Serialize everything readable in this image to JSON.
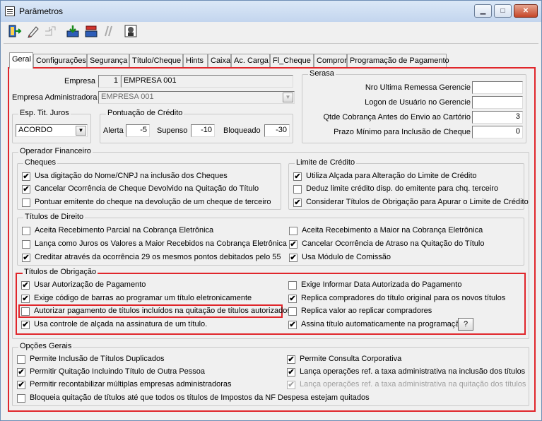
{
  "window": {
    "title": "Parâmetros",
    "minimize": "▁",
    "maximize": "□",
    "close": "✕"
  },
  "toolbar": {
    "icons": [
      "exit-icon",
      "edit-icon",
      "new-icon",
      "save-icon",
      "cancel-icon",
      "search-icon",
      "help-icon"
    ]
  },
  "tabs": [
    "Geral",
    "Configurações",
    "Segurança",
    "Título/Cheque",
    "Hints",
    "Caixa",
    "Ac. Carga",
    "Fl_Cheque",
    "Compror",
    "Programação de Pagamento"
  ],
  "active_tab": "Geral",
  "empresa": {
    "label": "Empresa",
    "code": "1",
    "name": "EMPRESA 001",
    "adm_label": "Empresa  Administradora",
    "adm_value": "EMPRESA 001"
  },
  "esp_tit_juros": {
    "title": "Esp. Tit. Juros",
    "value": "ACORDO"
  },
  "pontuacao": {
    "title": "Pontuação de Crédito",
    "alerta_label": "Alerta",
    "alerta": "-5",
    "supenso_label": "Supenso",
    "supenso": "-10",
    "bloqueado_label": "Bloqueado",
    "bloqueado": "-30"
  },
  "serasa": {
    "title": "Serasa",
    "nro_label": "Nro Ultima Remessa Gerencie",
    "nro": "",
    "logon_label": "Logon de Usuário no Gerencie",
    "logon": "",
    "qtde_label": "Qtde Cobrança  Antes do Envio ao Cartório",
    "qtde": "3",
    "prazo_label": "Prazo Mínimo para Inclusão de Cheque",
    "prazo": "0"
  },
  "operador": {
    "title": "Operador Financeiro",
    "cheques": {
      "title": "Cheques",
      "items": [
        {
          "label": "Usa digitação do Nome/CNPJ na inclusão dos Cheques",
          "checked": "✔"
        },
        {
          "label": "Cancelar Ocorrência de Cheque Devolvido na Quitação do Título",
          "checked": "✔"
        },
        {
          "label": "Pontuar emitente do cheque na devolução de um cheque de terceiro",
          "checked": ""
        }
      ]
    },
    "limite": {
      "title": "Limite de Crédito",
      "items": [
        {
          "label": "Utiliza Alçada para Alteração do Limite de Crédito",
          "checked": "✔"
        },
        {
          "label": "Deduz limite crédito disp. do emitente para chq. terceiro",
          "checked": ""
        },
        {
          "label": "Considerar Títulos de Obrigação para Apurar o Limite de Crédito",
          "checked": "✔"
        }
      ]
    },
    "direito": {
      "title": "Títulos de Direito",
      "left": [
        {
          "label": "Aceita Recebimento Parcial na Cobrança Eletrônica",
          "checked": ""
        },
        {
          "label": "Lança como Juros os Valores a Maior Recebidos na Cobrança Eletrônica",
          "checked": ""
        },
        {
          "label": "Creditar através da ocorrência 29 os mesmos pontos debitados pelo 55",
          "checked": "✔"
        }
      ],
      "right": [
        {
          "label": "Aceita Recebimento a Maior na Cobrança Eletrônica",
          "checked": ""
        },
        {
          "label": "Cancelar Ocorrência de Atraso na Quitação do Título",
          "checked": "✔"
        },
        {
          "label": "Usa Módulo de Comissão",
          "checked": "✔"
        }
      ]
    },
    "obrigacao": {
      "title": "Títulos de Obrigação",
      "left": [
        {
          "label": "Usar Autorização de Pagamento",
          "checked": "✔"
        },
        {
          "label": "Exige código de barras ao programar um título eletronicamente",
          "checked": "✔"
        },
        {
          "label": "Autorizar pagamento de títulos incluídos na quitação de títulos autorizados",
          "checked": ""
        },
        {
          "label": "Usa controle de alçada na assinatura de um título.",
          "checked": "✔"
        }
      ],
      "right": [
        {
          "label": "Exige Informar Data Autorizada do Pagamento",
          "checked": ""
        },
        {
          "label": "Replica compradores do título original para os novos títulos",
          "checked": "✔"
        },
        {
          "label": "Replica valor ao replicar compradores",
          "checked": ""
        },
        {
          "label": "Assina título automaticamente na programação.",
          "checked": "✔"
        }
      ],
      "help_button": "?"
    }
  },
  "opcoes": {
    "title": "Opções Gerais",
    "left": [
      {
        "label": "Permite Inclusão de Títulos Duplicados",
        "checked": ""
      },
      {
        "label": "Permitir Quitação Incluindo Título de Outra Pessoa",
        "checked": "✔"
      },
      {
        "label": "Permitir recontabilizar múltiplas empresas administradoras",
        "checked": "✔"
      },
      {
        "label": "Bloqueia quitação de títulos até que todos os títulos de Impostos da NF Despesa estejam quitados",
        "checked": ""
      }
    ],
    "right": [
      {
        "label": "Permite Consulta Corporativa",
        "checked": "✔"
      },
      {
        "label": "Lança operações ref. a taxa administrativa na inclusão dos títulos",
        "checked": "✔"
      },
      {
        "label": "Lança operações ref. a taxa administrativa na quitação dos títulos",
        "checked": "✔"
      }
    ]
  }
}
